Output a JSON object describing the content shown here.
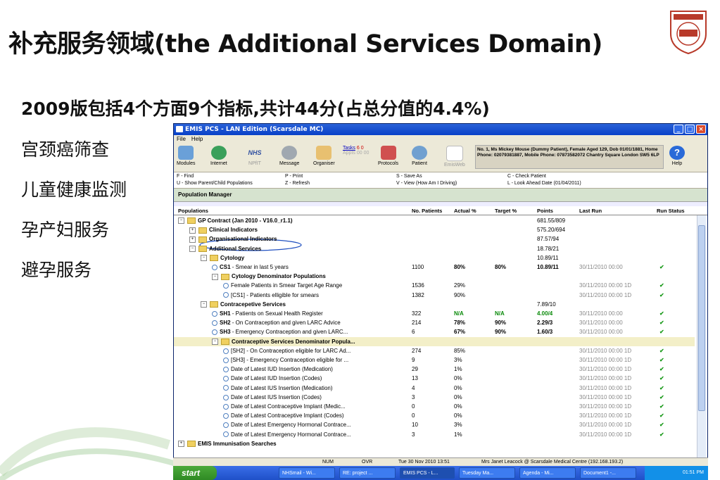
{
  "slide": {
    "title": "补充服务领域(the Additional Services Domain)",
    "subtitle": "2009版包括4个方面9个指标,共计44分(占总分值的4.4%)",
    "items": [
      "宫颈癌筛查",
      "儿童健康监测",
      "孕产妇服务",
      "避孕服务"
    ]
  },
  "window": {
    "title": "EMIS PCS - LAN Edition (Scarsdale MC)",
    "menu": [
      "File",
      "Help"
    ],
    "toolbar": {
      "modules": "Modules",
      "internet": "Internet",
      "nhs": "NHS",
      "npfit": "NPfIT",
      "message": "Message",
      "organiser": "Organiser",
      "tasks_label": "Tasks",
      "tasks_counts": "6 0",
      "appts_label": "Appts",
      "appts_counts": "00 00",
      "protocols": "Protocols",
      "patient": "Patient",
      "emisweb": "EmisWeb",
      "help": "Help"
    },
    "patient_info": "No. 1, Ms Mickey Mouse (Dummy Patient), Female Aged 129, Dob 01/01/1881, Home Phone: 02079381887, Mobile Phone: 07873582072 Chantry Square London SW5 6LP",
    "shortcuts": {
      "find": "F - Find",
      "show_parent": "U - Show Parent/Child Populations",
      "print": "P - Print",
      "refresh": "Z - Refresh",
      "save_as": "S - Save As",
      "view": "V - View (How Am I Driving)",
      "check_patient": "C - Check Patient",
      "look_ahead": "L - Look Ahead Date (01/04/2011)"
    },
    "panel_title": "Population Manager",
    "columns": [
      "Populations",
      "No. Patients",
      "Actual %",
      "Target %",
      "Points",
      "Last Run",
      "Run Status"
    ],
    "rows": [
      {
        "indent": 0,
        "type": "folder",
        "exp": "−",
        "name": "GP Contract (Jan 2010 - V16.0_r1.1)",
        "bold": true,
        "patients": "",
        "actual": "",
        "target": "",
        "points": "681.55/809",
        "lastrun": "",
        "status": ""
      },
      {
        "indent": 1,
        "type": "folder",
        "exp": "+",
        "name": "Clinical Indicators",
        "bold": true,
        "patients": "",
        "actual": "",
        "target": "",
        "points": "575.20/694",
        "lastrun": "",
        "status": ""
      },
      {
        "indent": 1,
        "type": "folder",
        "exp": "+",
        "name": "Organisational Indicators",
        "bold": true,
        "patients": "",
        "actual": "",
        "target": "",
        "points": "87.57/94",
        "lastrun": "",
        "status": ""
      },
      {
        "indent": 1,
        "type": "folder",
        "exp": "−",
        "name": "Additional Services",
        "bold": true,
        "patients": "",
        "actual": "",
        "target": "",
        "points": "18.78/21",
        "lastrun": "",
        "status": ""
      },
      {
        "indent": 2,
        "type": "folder",
        "exp": "−",
        "name": "Cytology",
        "bold": true,
        "patients": "",
        "actual": "",
        "target": "",
        "points": "10.89/11",
        "lastrun": "",
        "status": ""
      },
      {
        "indent": 3,
        "type": "report",
        "exp": "",
        "name": "CS1 - Smear in last 5 years",
        "code": "CS1",
        "bold": false,
        "patients": "1100",
        "actual": "80%",
        "target": "80%",
        "points": "10.89/11",
        "lastrun": "30/11/2010 00:00",
        "status": "✔"
      },
      {
        "indent": 3,
        "type": "folder",
        "exp": "−",
        "name": "Cytology Denominator Populations",
        "bold": true,
        "patients": "",
        "actual": "",
        "target": "",
        "points": "",
        "lastrun": "",
        "status": ""
      },
      {
        "indent": 4,
        "type": "report",
        "exp": "",
        "name": "Female Patients in Smear Target Age Range",
        "bold": false,
        "patients": "1536",
        "actual": "29%",
        "target": "",
        "points": "",
        "lastrun": "30/11/2010 00:00 1D",
        "status": "✔"
      },
      {
        "indent": 4,
        "type": "report",
        "exp": "",
        "name": "[CS1] - Patients elligible for smears",
        "bold": false,
        "patients": "1382",
        "actual": "90%",
        "target": "",
        "points": "",
        "lastrun": "30/11/2010 00:00 1D",
        "status": "✔"
      },
      {
        "indent": 2,
        "type": "folder",
        "exp": "−",
        "name": "Contracepetive Services",
        "bold": true,
        "patients": "",
        "actual": "",
        "target": "",
        "points": "7.89/10",
        "lastrun": "",
        "status": ""
      },
      {
        "indent": 3,
        "type": "report",
        "exp": "",
        "name": "SH1 - Patients on Sexual Health Register",
        "code": "SH1",
        "bold": false,
        "patients": "322",
        "actual": "N/A",
        "target": "N/A",
        "points": "4.00/4",
        "lastrun": "30/11/2010 00:00",
        "status": "✔",
        "green": true
      },
      {
        "indent": 3,
        "type": "report",
        "exp": "",
        "name": "SH2 - On Contraception and given LARC Advice",
        "code": "SH2",
        "bold": false,
        "patients": "214",
        "actual": "78%",
        "target": "90%",
        "points": "2.29/3",
        "lastrun": "30/11/2010 00:00",
        "status": "✔"
      },
      {
        "indent": 3,
        "type": "report",
        "exp": "",
        "name": "SH3 - Emergency Contraception and given LARC...",
        "code": "SH3",
        "bold": false,
        "patients": "6",
        "actual": "67%",
        "target": "90%",
        "points": "1.60/3",
        "lastrun": "30/11/2010 00:00",
        "status": "✔"
      },
      {
        "indent": 3,
        "type": "folder",
        "exp": "−",
        "name": "Contraceptive Services Denominator Popula...",
        "bold": true,
        "patients": "",
        "actual": "",
        "target": "",
        "points": "",
        "lastrun": "",
        "status": "",
        "highlight": true
      },
      {
        "indent": 4,
        "type": "report",
        "exp": "",
        "name": "[SH2] - On Contraception eligible for LARC Ad...",
        "bold": false,
        "patients": "274",
        "actual": "85%",
        "target": "",
        "points": "",
        "lastrun": "30/11/2010 00:00 1D",
        "status": "✔"
      },
      {
        "indent": 4,
        "type": "report",
        "exp": "",
        "name": "[SH3] - Emergency Contraception eligible for ...",
        "bold": false,
        "patients": "9",
        "actual": "3%",
        "target": "",
        "points": "",
        "lastrun": "30/11/2010 00:00 1D",
        "status": "✔"
      },
      {
        "indent": 4,
        "type": "report",
        "exp": "",
        "name": "Date of Latest IUD Insertion (Medication)",
        "bold": false,
        "patients": "29",
        "actual": "1%",
        "target": "",
        "points": "",
        "lastrun": "30/11/2010 00:00 1D",
        "status": "✔"
      },
      {
        "indent": 4,
        "type": "report",
        "exp": "",
        "name": "Date of Latest IUD Insertion (Codes)",
        "bold": false,
        "patients": "13",
        "actual": "0%",
        "target": "",
        "points": "",
        "lastrun": "30/11/2010 00:00 1D",
        "status": "✔"
      },
      {
        "indent": 4,
        "type": "report",
        "exp": "",
        "name": "Date of Latest IUS Insertion (Medication)",
        "bold": false,
        "patients": "4",
        "actual": "0%",
        "target": "",
        "points": "",
        "lastrun": "30/11/2010 00:00 1D",
        "status": "✔"
      },
      {
        "indent": 4,
        "type": "report",
        "exp": "",
        "name": "Date of Latest IUS Insertion (Codes)",
        "bold": false,
        "patients": "3",
        "actual": "0%",
        "target": "",
        "points": "",
        "lastrun": "30/11/2010 00:00 1D",
        "status": "✔"
      },
      {
        "indent": 4,
        "type": "report",
        "exp": "",
        "name": "Date of Latest Contraceptive Implant (Medic...",
        "bold": false,
        "patients": "0",
        "actual": "0%",
        "target": "",
        "points": "",
        "lastrun": "30/11/2010 00:00 1D",
        "status": "✔"
      },
      {
        "indent": 4,
        "type": "report",
        "exp": "",
        "name": "Date of Latest Contraceptive Implant (Codes)",
        "bold": false,
        "patients": "0",
        "actual": "0%",
        "target": "",
        "points": "",
        "lastrun": "30/11/2010 00:00 1D",
        "status": "✔"
      },
      {
        "indent": 4,
        "type": "report",
        "exp": "",
        "name": "Date of Latest Emergency Hormonal Contrace...",
        "bold": false,
        "patients": "10",
        "actual": "3%",
        "target": "",
        "points": "",
        "lastrun": "30/11/2010 00:00 1D",
        "status": "✔"
      },
      {
        "indent": 4,
        "type": "report",
        "exp": "",
        "name": "Date of Latest Emergency Hormonal Contrace...",
        "bold": false,
        "patients": "3",
        "actual": "1%",
        "target": "",
        "points": "",
        "lastrun": "30/11/2010 00:00 1D",
        "status": "✔"
      },
      {
        "indent": 0,
        "type": "folder",
        "exp": "+",
        "name": "EMIS Immunisation Searches",
        "bold": true,
        "patients": "",
        "actual": "",
        "target": "",
        "points": "",
        "lastrun": "",
        "status": ""
      }
    ],
    "status": {
      "num": "NUM",
      "ovr": "OVR",
      "datetime": "Tue 30 Nov 2010 13:51",
      "user": "Mrs Janet Leacock @ Scarsdale Medical Centre (192.168.193.2)"
    },
    "taskbar": {
      "start": "start",
      "tasks": [
        "NHSmail - Wi...",
        "RE: project ...",
        "EMIS PCS - L...",
        "Tuesday Ma...",
        "Agenda - Mi...",
        "Document1 -..."
      ],
      "clock": "01:51 PM"
    }
  },
  "colors": {
    "accent": "#0840c8",
    "highlight_circle": "#2050c0",
    "ok_tick": "#1a9a1a"
  }
}
